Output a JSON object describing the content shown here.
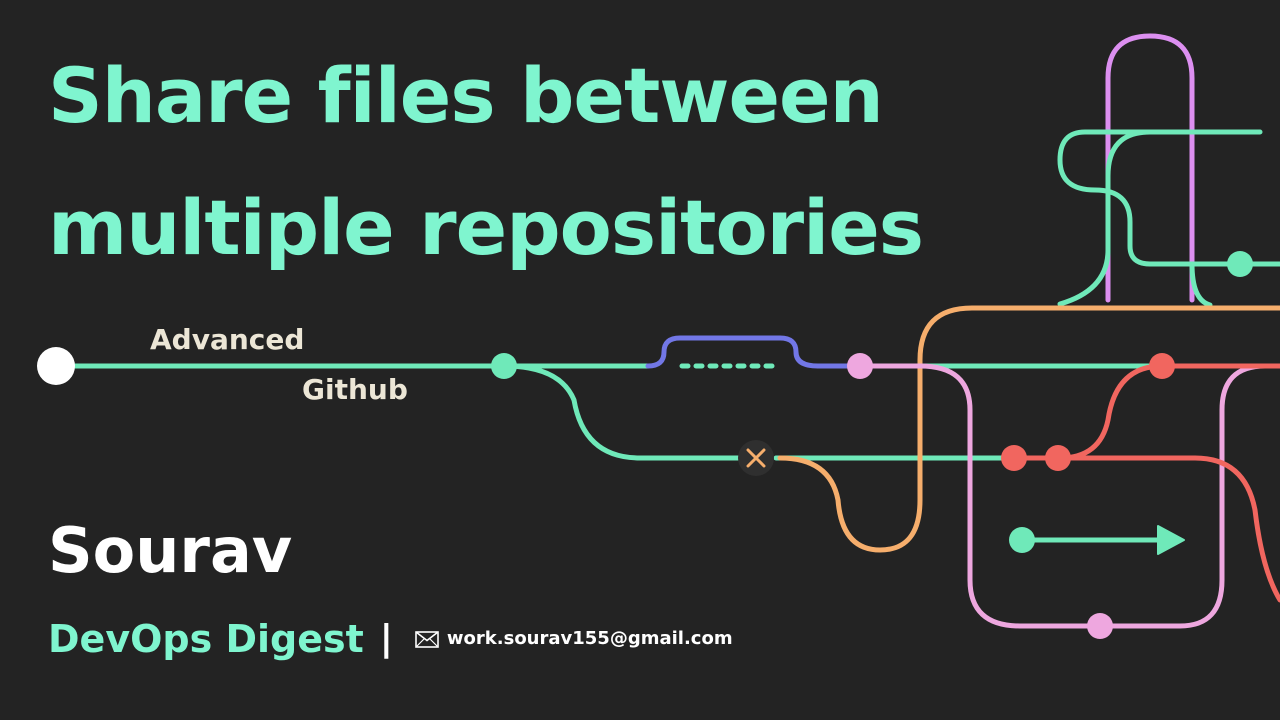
{
  "title": {
    "line1": "Share files between",
    "line2": "multiple repositories"
  },
  "tagline": {
    "line1": "Advanced",
    "line2": "Github"
  },
  "author": {
    "name": "Sourav",
    "brand": "DevOps Digest",
    "separator": "|",
    "email": "work.sourav155@gmail.com"
  },
  "icons": {
    "email": "envelope-icon",
    "merge_conflict": "x-icon",
    "arrow": "arrow-right-icon"
  },
  "colors": {
    "background": "#232323",
    "title": "#7ff5cf",
    "branch_green": "#6fe9b9",
    "branch_purple": "#dc8ff0",
    "branch_blue": "#7277e6",
    "branch_pink": "#eea7df",
    "branch_orange": "#f6ae6c",
    "branch_red": "#f1665f",
    "node_white": "#ffffff"
  }
}
